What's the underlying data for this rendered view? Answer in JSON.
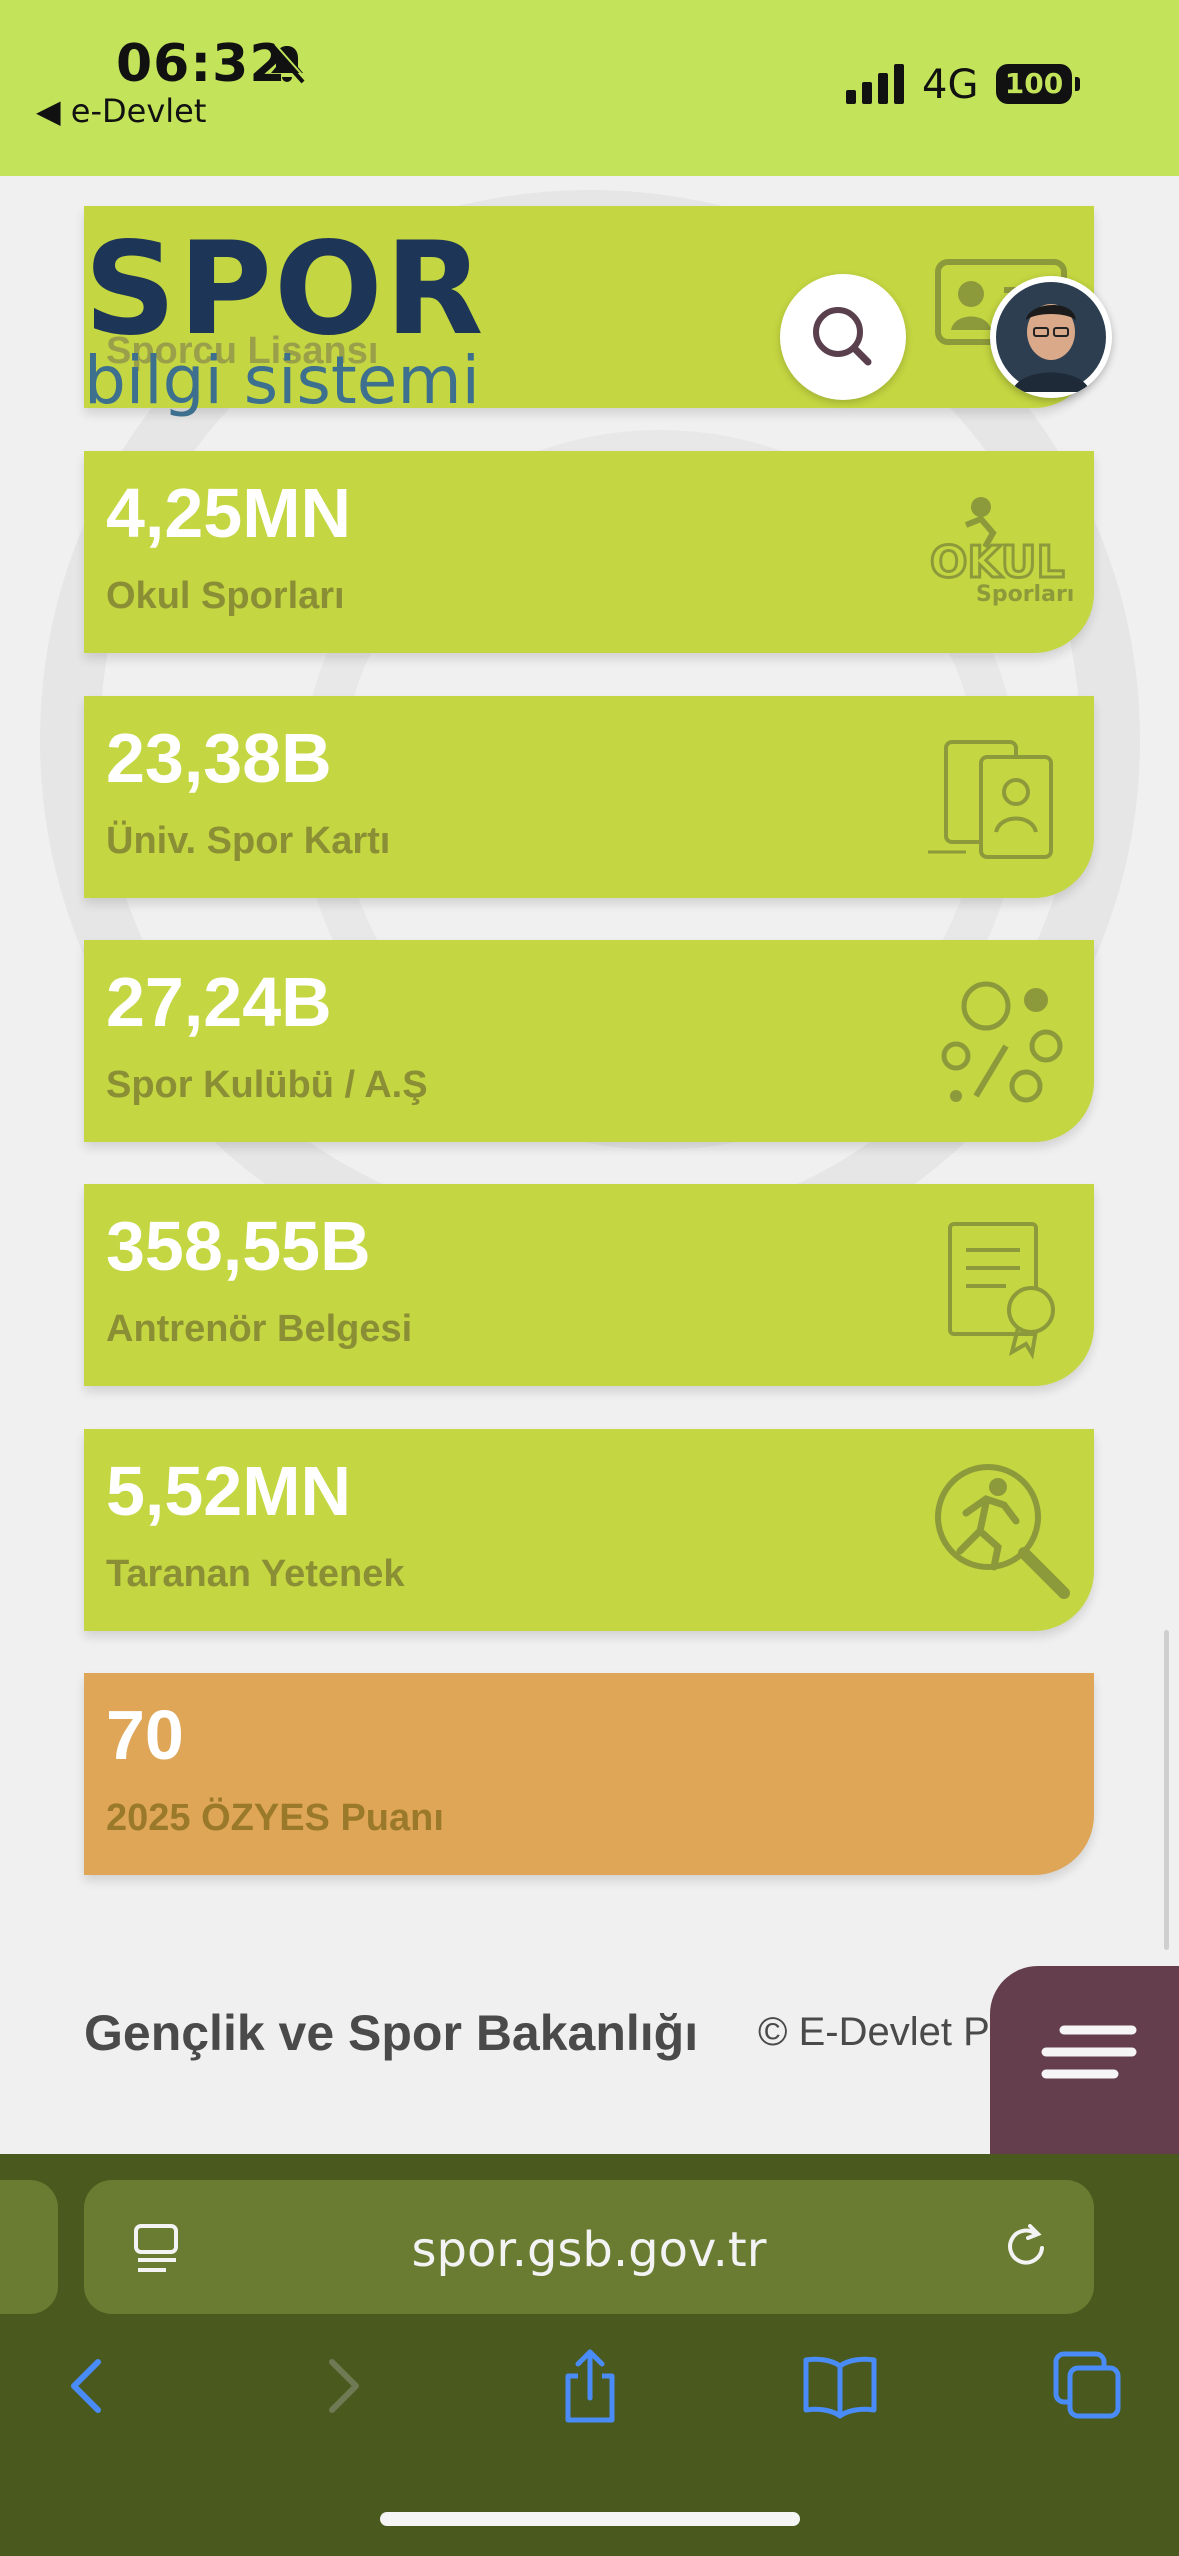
{
  "status_bar": {
    "time": "06:32",
    "back_app": "◀ e-Devlet",
    "network": "4G",
    "battery": "100"
  },
  "header": {
    "logo_word": "SPOR",
    "logo_sub": "bilgi sistemi"
  },
  "cards": [
    {
      "value": "",
      "label": "Sporcu Lisansı",
      "icon": "id-card-icon"
    },
    {
      "value": "4,25MN",
      "label": "Okul Sporları",
      "icon": "okul-sporlari-logo-icon"
    },
    {
      "value": "23,38B",
      "label": "Üniv. Spor Kartı",
      "icon": "sport-card-icon"
    },
    {
      "value": "27,24B",
      "label": "Spor Kulübü / A.Ş",
      "icon": "sports-equipment-icon"
    },
    {
      "value": "358,55B",
      "label": "Antrenör Belgesi",
      "icon": "certificate-icon"
    },
    {
      "value": "5,52MN",
      "label": "Taranan Yetenek",
      "icon": "talent-search-icon"
    },
    {
      "value": "70",
      "label": "2025 ÖZYES Puanı",
      "icon": ""
    }
  ],
  "footer": {
    "ministry": "Gençlik ve Spor Bakanlığı",
    "copyright": "© E-Devlet P"
  },
  "browser": {
    "url": "spor.gsb.gov.tr"
  },
  "colors": {
    "accent_green": "#c4d641",
    "status_green": "#c2e35a",
    "orange": "#dea656",
    "fab": "#653e4e",
    "browser_bar": "#4a5a1e"
  }
}
